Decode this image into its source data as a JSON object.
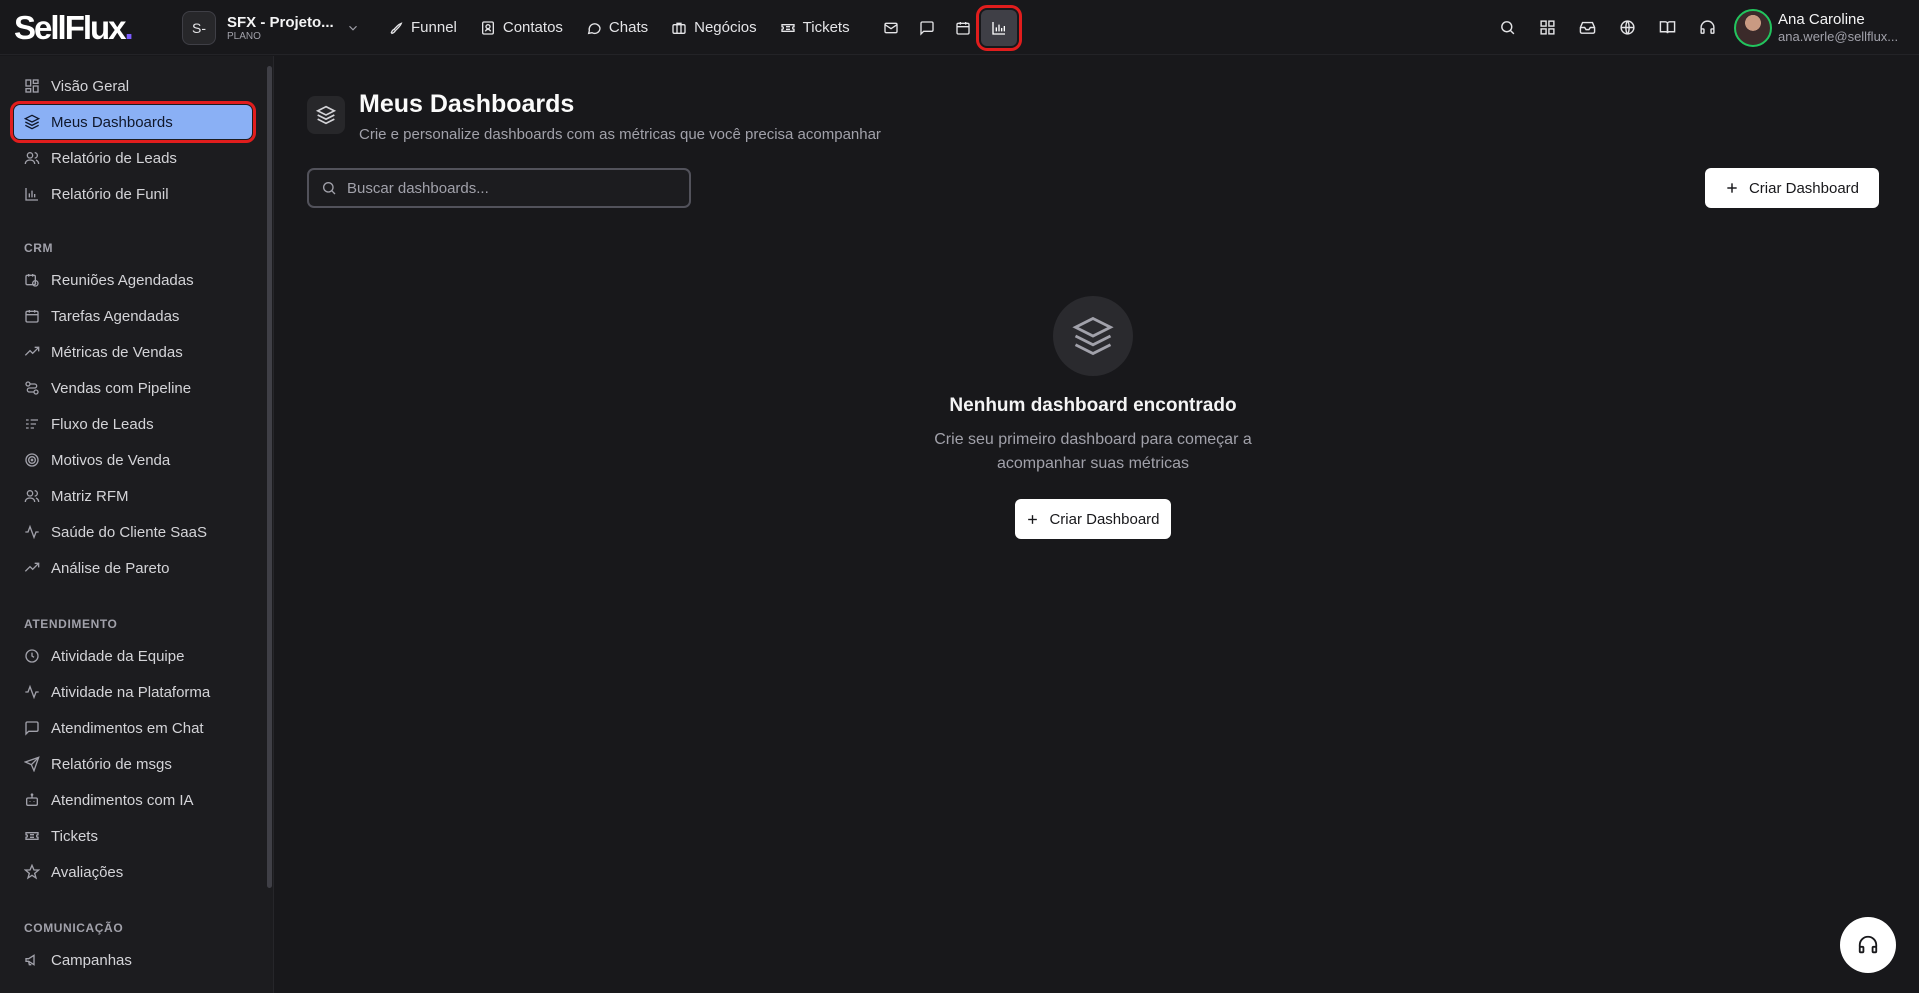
{
  "brand": {
    "logo_text": "SellFlux",
    "logo_dot": "."
  },
  "project": {
    "badge": "S-",
    "name": "SFX - Projeto...",
    "plan": "PLANO"
  },
  "nav": {
    "items": [
      {
        "label": "Funnel",
        "icon": "rocket-icon"
      },
      {
        "label": "Contatos",
        "icon": "contact-icon"
      },
      {
        "label": "Chats",
        "icon": "chat-icon"
      },
      {
        "label": "Negócios",
        "icon": "briefcase-icon"
      },
      {
        "label": "Tickets",
        "icon": "ticket-icon"
      }
    ],
    "icon_buttons": [
      "mail-icon",
      "message-square-icon",
      "calendar-icon",
      "bar-chart-icon"
    ]
  },
  "right_icons": [
    "search-icon",
    "grid-icon",
    "inbox-icon",
    "globe-icon",
    "book-icon",
    "headset-icon"
  ],
  "user": {
    "name": "Ana Caroline",
    "email": "ana.werle@sellflux..."
  },
  "sidebar": {
    "top_items": [
      {
        "label": "Visão Geral",
        "icon": "dashboard-grid-icon"
      },
      {
        "label": "Meus Dashboards",
        "icon": "layers-icon",
        "active": true
      },
      {
        "label": "Relatório de Leads",
        "icon": "users-icon"
      },
      {
        "label": "Relatório de Funil",
        "icon": "bar-chart-icon"
      }
    ],
    "crm_title": "CRM",
    "crm_items": [
      {
        "label": "Reuniões Agendadas",
        "icon": "calendar-clock-icon"
      },
      {
        "label": "Tarefas Agendadas",
        "icon": "calendar-icon"
      },
      {
        "label": "Métricas de Vendas",
        "icon": "trending-up-icon"
      },
      {
        "label": "Vendas com Pipeline",
        "icon": "pipeline-icon"
      },
      {
        "label": "Fluxo de Leads",
        "icon": "list-filter-icon"
      },
      {
        "label": "Motivos de Venda",
        "icon": "target-icon"
      },
      {
        "label": "Matriz RFM",
        "icon": "users-icon"
      },
      {
        "label": "Saúde do Cliente SaaS",
        "icon": "activity-icon"
      },
      {
        "label": "Análise de Pareto",
        "icon": "trending-up-icon"
      }
    ],
    "atendimento_title": "ATENDIMENTO",
    "atendimento_items": [
      {
        "label": "Atividade da Equipe",
        "icon": "clock-icon"
      },
      {
        "label": "Atividade na Plataforma",
        "icon": "activity-icon"
      },
      {
        "label": "Atendimentos em Chat",
        "icon": "message-square-icon"
      },
      {
        "label": "Relatório de msgs",
        "icon": "send-icon"
      },
      {
        "label": "Atendimentos com IA",
        "icon": "bot-icon"
      },
      {
        "label": "Tickets",
        "icon": "ticket-icon"
      },
      {
        "label": "Avaliações",
        "icon": "star-icon"
      }
    ],
    "comunicacao_title": "COMUNICAÇÃO",
    "comunicacao_items": [
      {
        "label": "Campanhas",
        "icon": "megaphone-icon"
      }
    ]
  },
  "main": {
    "title": "Meus Dashboards",
    "subtitle": "Crie e personalize dashboards com as métricas que você precisa acompanhar",
    "search_placeholder": "Buscar dashboards...",
    "create_button": "Criar Dashboard",
    "empty_title": "Nenhum dashboard encontrado",
    "empty_desc": "Crie seu primeiro dashboard para começar a acompanhar suas métricas",
    "empty_button": "Criar Dashboard"
  },
  "colors": {
    "accent_active": "#8ab0f5",
    "highlight_outline": "#e11d1d",
    "online": "#22c55e",
    "brand_dot": "#7c5cff"
  }
}
